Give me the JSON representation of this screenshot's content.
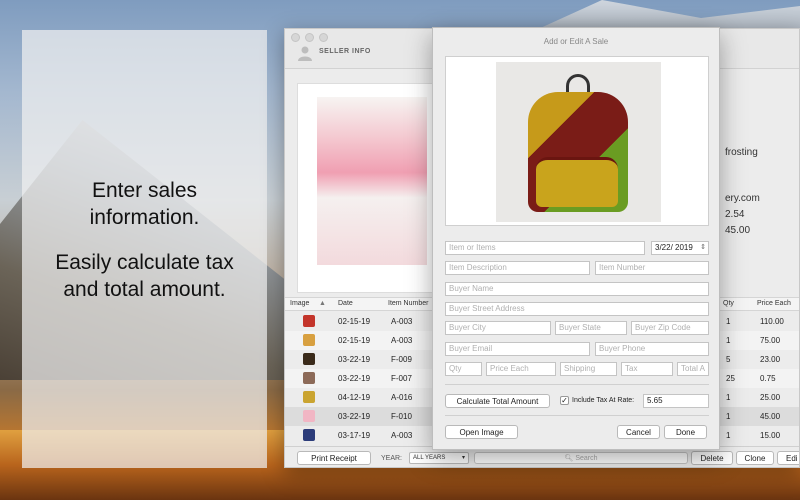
{
  "promo": {
    "line1": "Enter sales information.",
    "line2": "Easily calculate tax and total amount."
  },
  "window": {
    "seller_info_label": "SELLER INFO",
    "details": [
      "frosting",
      "ery.com",
      "2.54",
      "45.00"
    ]
  },
  "table": {
    "headers": {
      "image": "Image",
      "date": "Date",
      "item_number": "Item Number",
      "qty": "Qty",
      "price_each": "Price Each"
    },
    "rows": [
      {
        "date": "02-15-19",
        "item": "A-003",
        "qty": "1",
        "price": "110.00",
        "thumb_color": "#c3342a"
      },
      {
        "date": "02-15-19",
        "item": "A-003",
        "qty": "1",
        "price": "75.00",
        "thumb_color": "#d8a040"
      },
      {
        "date": "03-22-19",
        "item": "F-009",
        "qty": "5",
        "price": "23.00",
        "thumb_color": "#3a2a1a"
      },
      {
        "date": "03-22-19",
        "item": "F-007",
        "qty": "25",
        "price": "0.75",
        "thumb_color": "#8c6a58"
      },
      {
        "date": "04-12-19",
        "item": "A-016",
        "qty": "1",
        "price": "25.00",
        "thumb_color": "#caa430"
      },
      {
        "date": "03-22-19",
        "item": "F-010",
        "qty": "1",
        "price": "45.00",
        "thumb_color": "#f1b6c4"
      },
      {
        "date": "03-17-19",
        "item": "A-003",
        "qty": "1",
        "price": "15.00",
        "thumb_color": "#2c3c7a"
      }
    ]
  },
  "bottom_bar": {
    "print_receipt": "Print Receipt",
    "year_label": "YEAR:",
    "year_value": "ALL YEARS",
    "search_placeholder": "Search",
    "delete": "Delete",
    "clone": "Clone",
    "edit": "Edi"
  },
  "dialog": {
    "title": "Add or Edit A Sale",
    "date_value": "3/22/ 2019",
    "placeholders": {
      "item": "Item or Items",
      "description": "Item Description",
      "item_number": "Item Number",
      "buyer_name": "Buyer Name",
      "street": "Buyer Street Address",
      "city": "Buyer City",
      "state": "Buyer State",
      "zip": "Buyer Zip Code",
      "email": "Buyer Email",
      "phone": "Buyer Phone",
      "qty": "Qty",
      "price_each": "Price Each",
      "shipping": "Shipping",
      "tax": "Tax",
      "total": "Total A"
    },
    "calc_button": "Calculate Total Amount",
    "include_tax_label": "Include Tax At Rate:",
    "include_tax_checked": "✓",
    "tax_rate": "5.65",
    "open_image": "Open Image",
    "cancel": "Cancel",
    "done": "Done"
  }
}
